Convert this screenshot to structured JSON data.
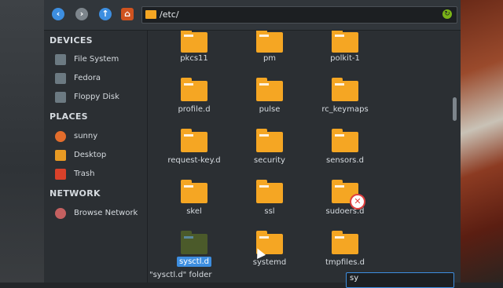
{
  "toolbar": {
    "back_icon": "arrow-left-icon",
    "forward_icon": "arrow-right-icon",
    "up_icon": "arrow-up-icon",
    "home_icon": "home-icon",
    "path": "/etc/",
    "reload_icon": "reload-icon"
  },
  "sidebar": {
    "devices_title": "DEVICES",
    "devices": [
      {
        "label": "File System",
        "icon": "drive-icon"
      },
      {
        "label": "Fedora",
        "icon": "drive-icon"
      },
      {
        "label": "Floppy Disk",
        "icon": "floppy-icon"
      }
    ],
    "places_title": "PLACES",
    "places": [
      {
        "label": "sunny",
        "icon": "home-icon"
      },
      {
        "label": "Desktop",
        "icon": "desktop-icon"
      },
      {
        "label": "Trash",
        "icon": "trash-icon"
      }
    ],
    "network_title": "NETWORK",
    "network": [
      {
        "label": "Browse Network",
        "icon": "network-icon"
      }
    ]
  },
  "files": [
    {
      "name": "pkcs11"
    },
    {
      "name": "pm"
    },
    {
      "name": "polkit-1"
    },
    {
      "name": "profile.d"
    },
    {
      "name": "pulse"
    },
    {
      "name": "rc_keymaps"
    },
    {
      "name": "request-key.d"
    },
    {
      "name": "security"
    },
    {
      "name": "sensors.d"
    },
    {
      "name": "skel"
    },
    {
      "name": "ssl"
    },
    {
      "name": "sudoers.d"
    },
    {
      "name": "sysctl.d"
    },
    {
      "name": "systemd"
    },
    {
      "name": "tmpfiles.d"
    }
  ],
  "selected_file": "sysctl.d",
  "emblem_icon": "no-access-icon",
  "status": {
    "text": "\"sysctl.d\" folder"
  },
  "search": {
    "value": "sy"
  },
  "colors": {
    "accent": "#3d8ee0",
    "folder": "#f5a623",
    "window_bg": "#2b2f33"
  }
}
